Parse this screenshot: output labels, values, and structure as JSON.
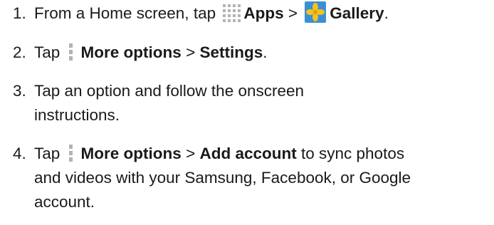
{
  "steps": [
    {
      "number": "1.",
      "line1_prefix": "From a Home screen, tap",
      "apps_label": "Apps",
      "separator": ">",
      "gallery_label": "Gallery",
      "end": "."
    },
    {
      "number": "2.",
      "prefix": "Tap",
      "more_options_label": "More options",
      "separator": ">",
      "settings_label": "Settings",
      "end": "."
    },
    {
      "number": "3.",
      "text": "Tap an option and follow the onscreen instructions."
    },
    {
      "number": "4.",
      "prefix": "Tap",
      "more_options_label": "More options",
      "separator": ">",
      "add_account_label": "Add account",
      "suffix": "to sync photos and videos with your Samsung, Facebook, or Google account."
    }
  ],
  "icons": {
    "apps": "apps-grid-icon",
    "gallery": "gallery-icon",
    "more_options": "more-options-icon"
  },
  "colors": {
    "text": "#1a1a1a",
    "icon_gray": "#b3b3b3",
    "gallery_blue": "#3b8fd6",
    "gallery_yellow": "#f6c21a"
  }
}
